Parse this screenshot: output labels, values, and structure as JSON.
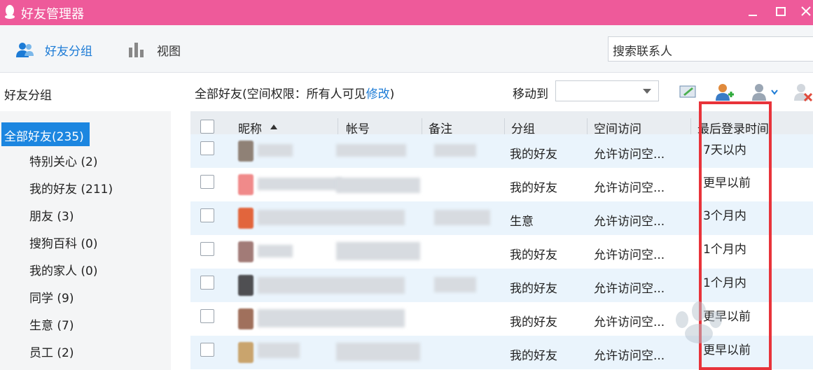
{
  "window": {
    "title": "好友管理器"
  },
  "toolbar": {
    "groups_label": "好友分组",
    "view_label": "视图"
  },
  "search": {
    "placeholder": "搜索联系人"
  },
  "sidebar": {
    "header": "好友分组",
    "groups": [
      {
        "label": "全部好友(235)",
        "selected": true
      },
      {
        "label": "特别关心 (2)"
      },
      {
        "label": "我的好友 (211)"
      },
      {
        "label": "朋友 (3)"
      },
      {
        "label": "搜狗百科 (0)"
      },
      {
        "label": "我的家人 (0)"
      },
      {
        "label": "同学 (9)"
      },
      {
        "label": "生意 (7)"
      },
      {
        "label": "员工 (2)"
      }
    ]
  },
  "main": {
    "scope_prefix": "全部好友(空间权限：所有人可见",
    "scope_edit": "修改",
    "scope_suffix": ")",
    "move_to_label": "移动到",
    "columns": {
      "nickname": "昵称",
      "account": "帐号",
      "remark": "备注",
      "group": "分组",
      "space": "空间访问",
      "last_login": "最后登录时间"
    },
    "rows": [
      {
        "group": "我的好友",
        "space": "允许访问空...",
        "last_login": "7天以内"
      },
      {
        "group": "我的好友",
        "space": "允许访问空...",
        "last_login": "更早以前"
      },
      {
        "group": "生意",
        "space": "允许访问空...",
        "last_login": "3个月内"
      },
      {
        "group": "我的好友",
        "space": "允许访问空...",
        "last_login": "1个月内"
      },
      {
        "group": "我的好友",
        "space": "允许访问空...",
        "last_login": "1个月内"
      },
      {
        "group": "我的好友",
        "space": "允许访问空...",
        "last_login": "更早以前"
      },
      {
        "group": "我的好友",
        "space": "允许访问空...",
        "last_login": "更早以前"
      }
    ]
  },
  "colors": {
    "titlebar": "#ee5a9a",
    "accent": "#1c86e0",
    "highlight_box": "#e8333a"
  }
}
